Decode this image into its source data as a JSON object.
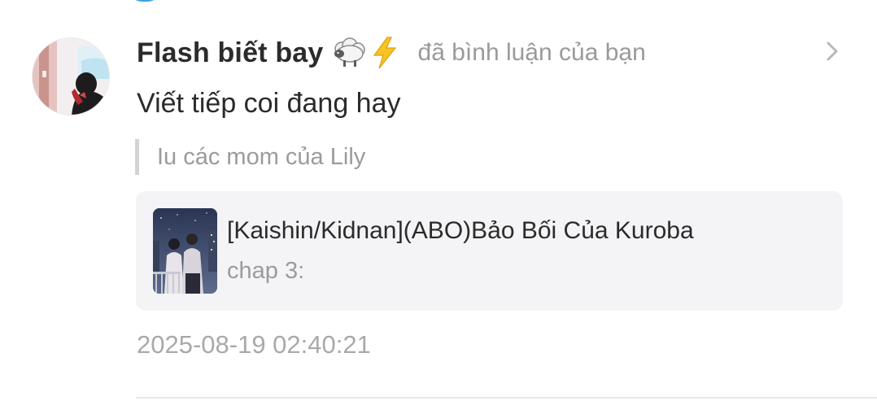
{
  "notification": {
    "username": "Flash biết bay",
    "username_emojis": [
      "sheep-icon",
      "lightning-icon"
    ],
    "action": "đã bình luận của bạn",
    "comment": "Viết tiếp coi đang hay",
    "quoted_reply": "Iu các mom của Lily",
    "story": {
      "title": "[Kaishin/Kidnan](ABO)Bảo Bối Của Kuroba",
      "chapter": "chap 3:"
    },
    "timestamp": "2025-08-19 02:40:21"
  },
  "colors": {
    "primary_text": "#2b2b2b",
    "secondary_text": "#9a9a9a",
    "card_background": "#f4f4f6",
    "quote_bar": "#d3d3d3",
    "divider": "#e6e6e6",
    "top_accent": "#3fa0e6"
  }
}
